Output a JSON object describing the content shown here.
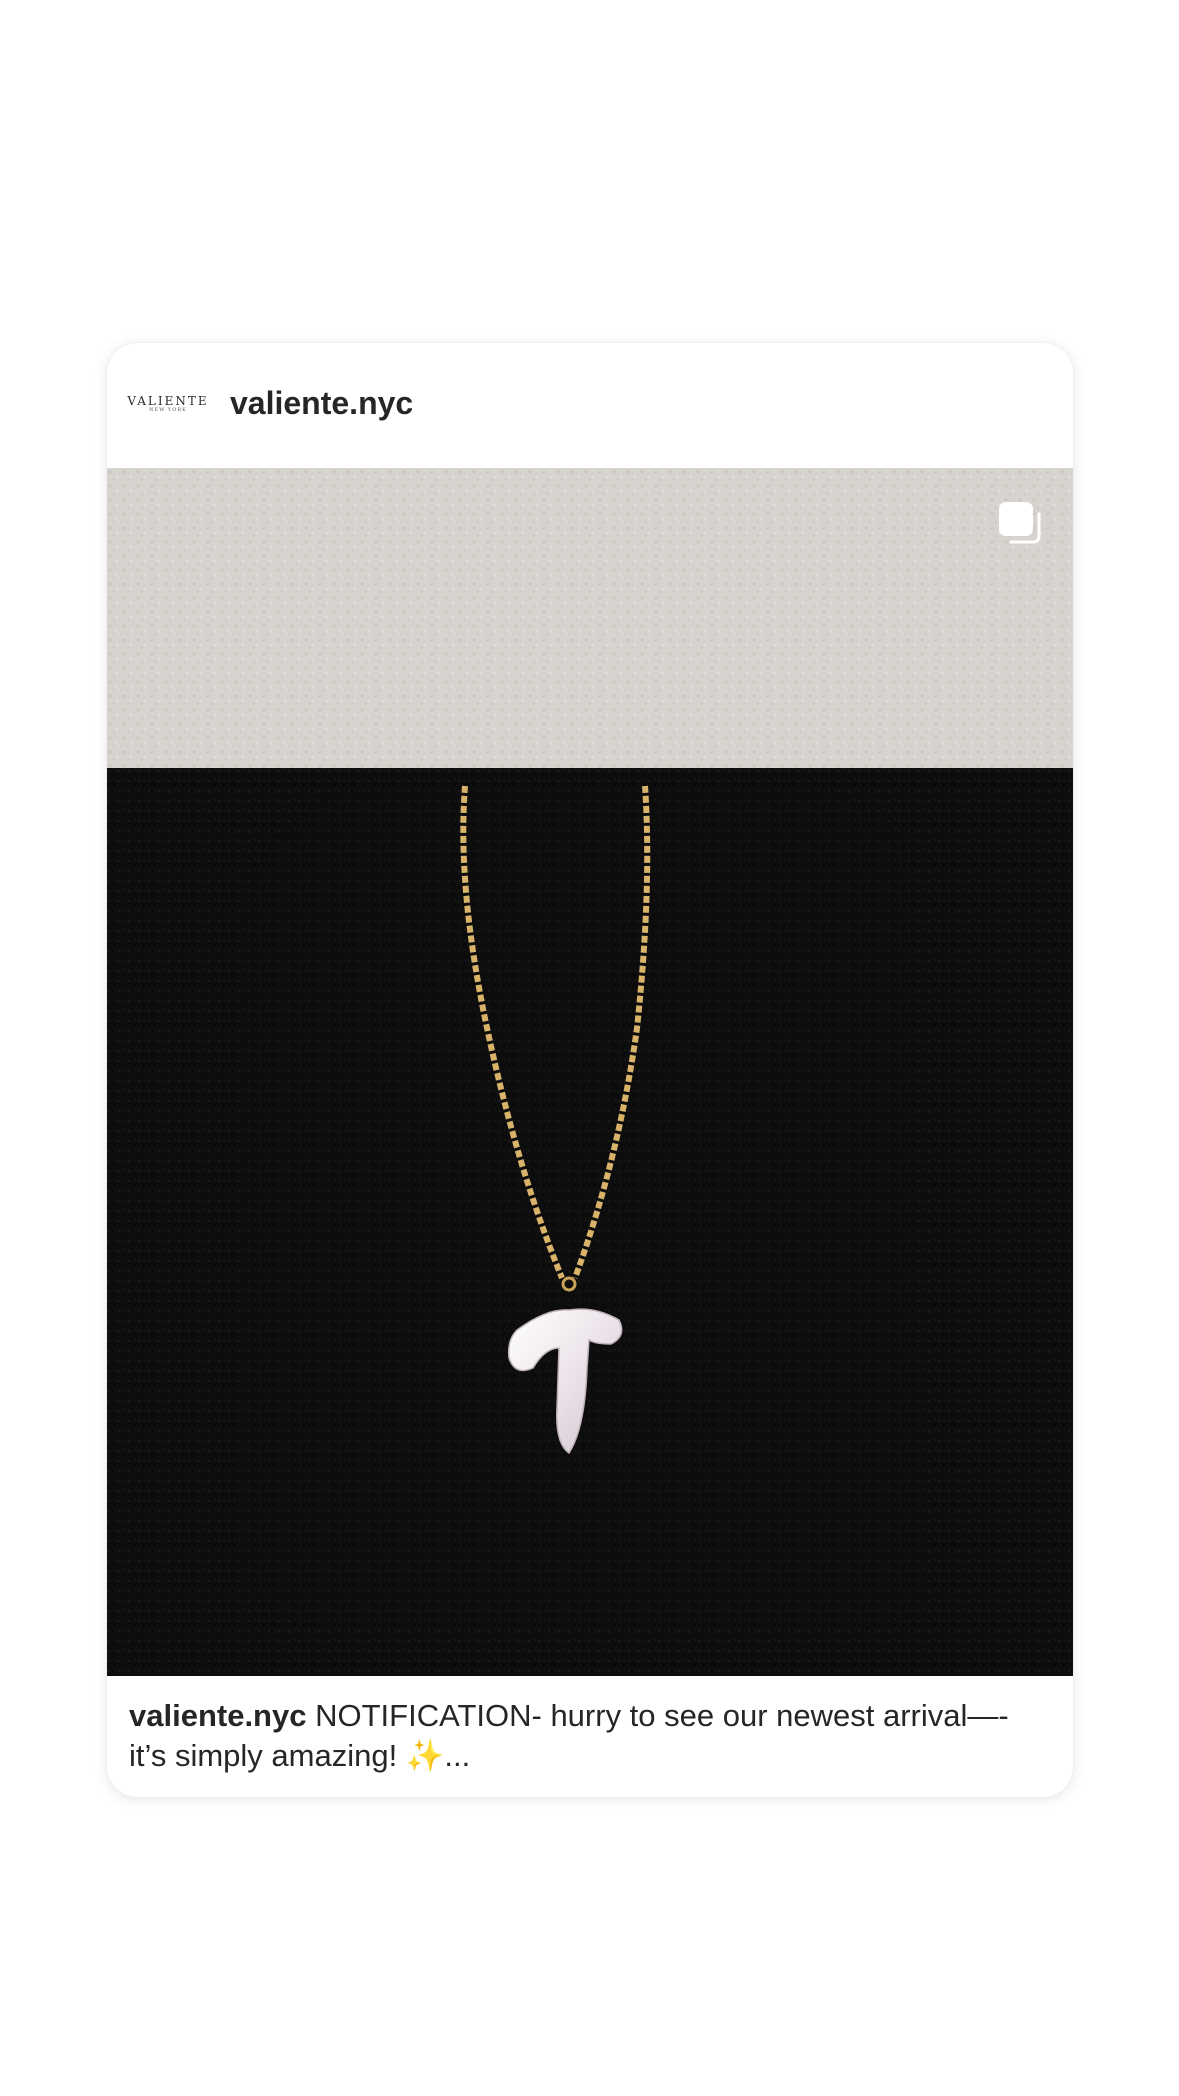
{
  "post": {
    "avatar_brand": "VALIENTE",
    "avatar_sub": "NEW YORK",
    "username": "valiente.nyc",
    "caption_user": "valiente.nyc",
    "caption_text": " NOTIFICATION- hurry to see our newest arrival—- it’s simply amazing! ✨...",
    "media_type_icon": "carousel-icon",
    "photo_description_icon": "necklace-photo"
  },
  "colors": {
    "text": "#262626",
    "wall": "#d6d2cd",
    "sofa": "#0c0c0c",
    "chain": "#d9b36a",
    "pendant": "#efe9ec"
  }
}
